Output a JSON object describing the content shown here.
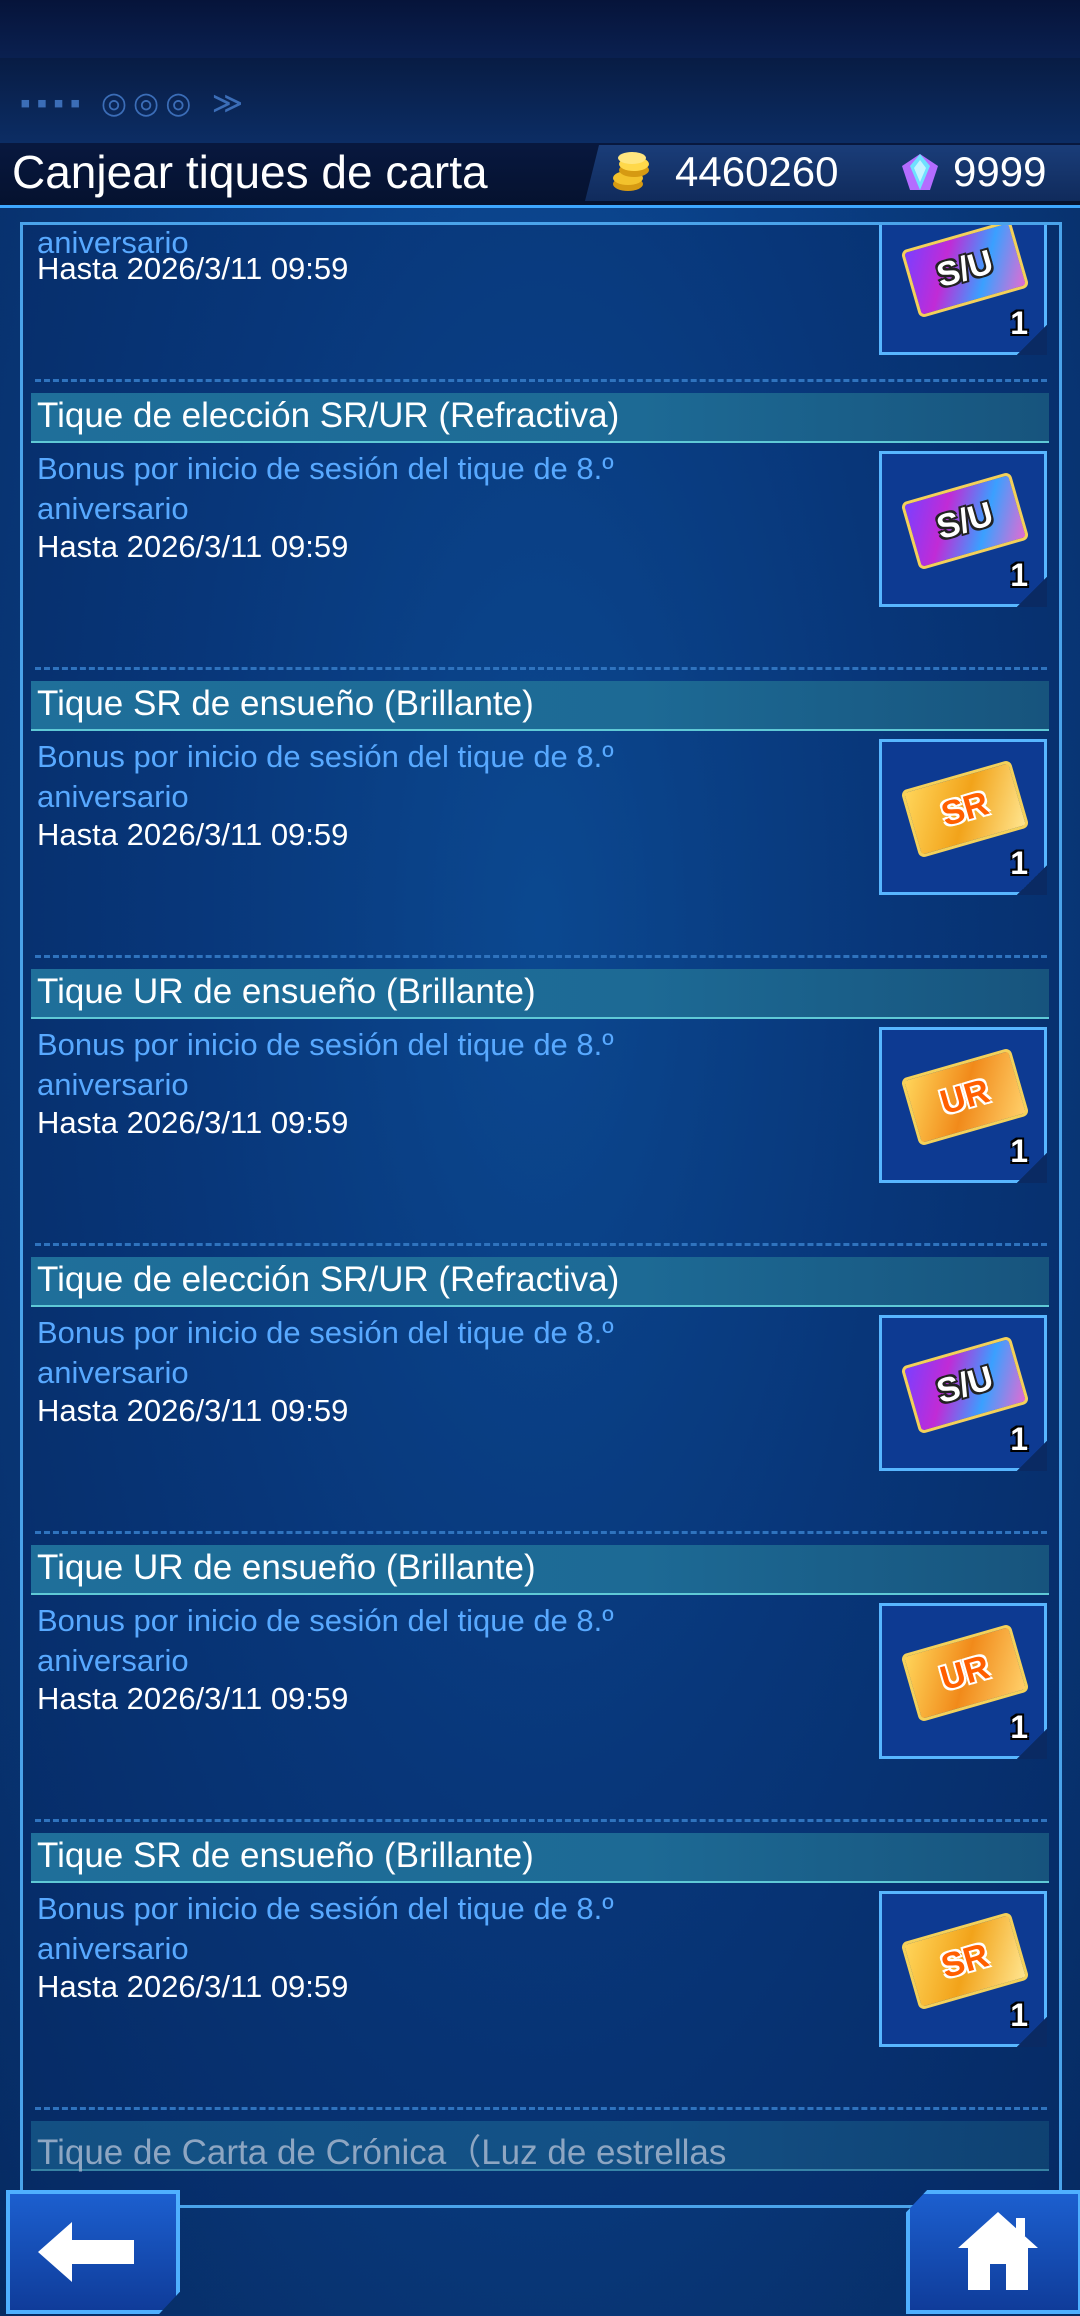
{
  "header": {
    "title": "Canjear tiques de carta",
    "gold": "4460260",
    "gems": "9999",
    "gold_icon": "gold-coins-icon",
    "gem_icon": "gem-icon"
  },
  "partial_top": {
    "desc_tail": "aniversario",
    "until": "Hasta 2026/3/11 09:59",
    "ticket_label": "S/U",
    "qty": "1"
  },
  "items": [
    {
      "name": "Tique de elección SR/UR (Refractiva)",
      "desc": "Bonus por inicio de sesión del tique de 8.º aniversario",
      "until": "Hasta 2026/3/11 09:59",
      "ticket_label": "S/U",
      "qty": "1"
    },
    {
      "name": "Tique SR de ensueño (Brillante)",
      "desc": "Bonus por inicio de sesión del tique de 8.º aniversario",
      "until": "Hasta 2026/3/11 09:59",
      "ticket_label": "SR",
      "qty": "1"
    },
    {
      "name": "Tique UR de ensueño (Brillante)",
      "desc": "Bonus por inicio de sesión del tique de 8.º aniversario",
      "until": "Hasta 2026/3/11 09:59",
      "ticket_label": "UR",
      "qty": "1"
    },
    {
      "name": "Tique de elección SR/UR (Refractiva)",
      "desc": "Bonus por inicio de sesión del tique de 8.º aniversario",
      "until": "Hasta 2026/3/11 09:59",
      "ticket_label": "S/U",
      "qty": "1"
    },
    {
      "name": "Tique UR de ensueño (Brillante)",
      "desc": "Bonus por inicio de sesión del tique de 8.º aniversario",
      "until": "Hasta 2026/3/11 09:59",
      "ticket_label": "UR",
      "qty": "1"
    },
    {
      "name": "Tique SR de ensueño (Brillante)",
      "desc": "Bonus por inicio de sesión del tique de 8.º aniversario",
      "until": "Hasta 2026/3/11 09:59",
      "ticket_label": "SR",
      "qty": "1"
    }
  ],
  "partial_bottom": {
    "name": "Tique de Carta de Crónica（Luz de estrellas"
  },
  "footer": {
    "back_icon": "back-arrow-icon",
    "home_icon": "home-icon"
  }
}
